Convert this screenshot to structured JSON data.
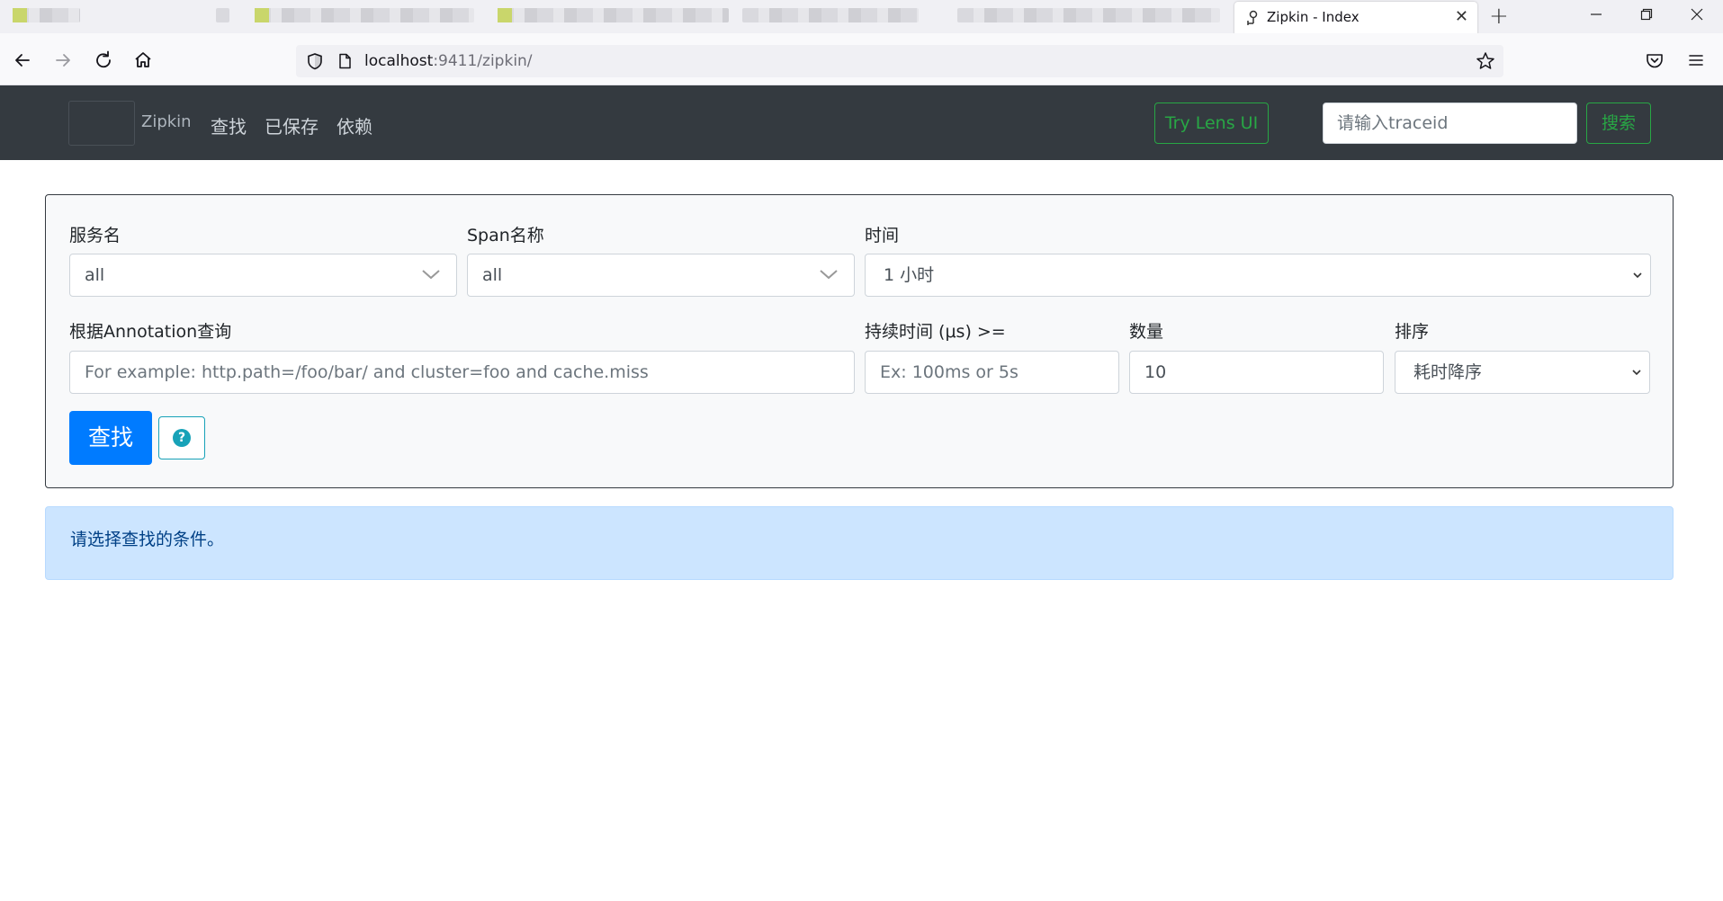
{
  "browser": {
    "active_tab_title": "Zipkin - Index",
    "url_host": "localhost",
    "url_rest": ":9411/zipkin/"
  },
  "navbar": {
    "brand": "Zipkin",
    "links": [
      "查找",
      "已保存",
      "依赖"
    ],
    "lens_button": "Try Lens UI",
    "traceid_placeholder": "请输入traceid",
    "search_button": "搜索"
  },
  "form": {
    "service_name": {
      "label": "服务名",
      "value": "all"
    },
    "span_name": {
      "label": "Span名称",
      "value": "all"
    },
    "time": {
      "label": "时间",
      "value": "1 小时"
    },
    "annotation": {
      "label": "根据Annotation查询",
      "placeholder": "For example: http.path=/foo/bar/ and cluster=foo and cache.miss"
    },
    "duration": {
      "label": "持续时间 (μs) >=",
      "placeholder": "Ex: 100ms or 5s"
    },
    "limit": {
      "label": "数量",
      "value": "10"
    },
    "sort": {
      "label": "排序",
      "value": "耗时降序"
    },
    "find_button": "查找",
    "help_icon_glyph": "?"
  },
  "alert": {
    "message": "请选择查找的条件。"
  },
  "colors": {
    "navbar_bg": "#343a40",
    "success": "#28a745",
    "primary": "#007bff",
    "info": "#17a2b8",
    "alert_bg": "#cce5ff",
    "alert_text": "#004085"
  }
}
